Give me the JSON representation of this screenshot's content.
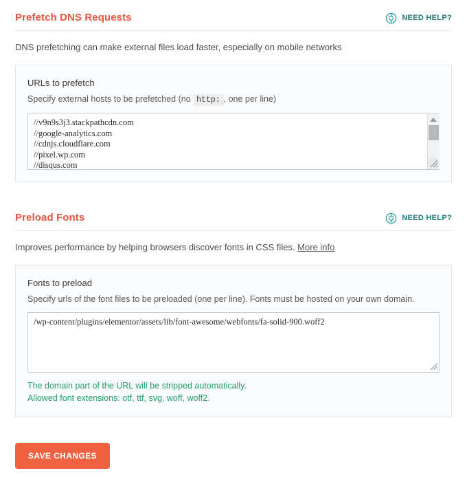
{
  "sections": [
    {
      "id": "dns",
      "title": "Prefetch DNS Requests",
      "help": {
        "label": "NEED HELP?",
        "icon": "lifebuoy-icon"
      },
      "description": "DNS prefetching can make external files load faster, especially on mobile networks",
      "panel": {
        "field_label": "URLs to prefetch",
        "help_prefix": "Specify external hosts to be prefetched (no",
        "help_code": "http:",
        "help_suffix": ", one per line)",
        "textarea_value": "//v9n9s3j3.stackpathcdn.com\n//google-analytics.com\n//cdnjs.cloudflare.com\n//pixel.wp.com\n//disqus.com\n//youtube.com",
        "textarea_placeholder": ""
      }
    },
    {
      "id": "fonts",
      "title": "Preload Fonts",
      "help": {
        "label": "NEED HELP?",
        "icon": "lifebuoy-icon"
      },
      "description_prefix": "Improves performance by helping browsers discover fonts in CSS files.",
      "description_link": "More info",
      "panel": {
        "field_label": "Fonts to preload",
        "help_text": "Specify urls of the font files to be preloaded (one per line). Fonts must be hosted on your own domain.",
        "textarea_value": "/wp-content/plugins/elementor/assets/lib/font-awesome/webfonts/fa-solid-900.woff2",
        "textarea_placeholder": "",
        "note_line_1": "The domain part of the URL will be stripped automatically.",
        "note_line_2": "Allowed font extensions: otf, ttf, svg, woff, woff2."
      }
    }
  ],
  "footer": {
    "save_label": "SAVE CHANGES"
  },
  "colors": {
    "heading": "#e8563f",
    "help_link": "#1d7a78",
    "note_green": "#25a06a",
    "save_button": "#ef6140",
    "panel_bg": "#fafbfc",
    "panel_border": "#e4e6e8"
  }
}
